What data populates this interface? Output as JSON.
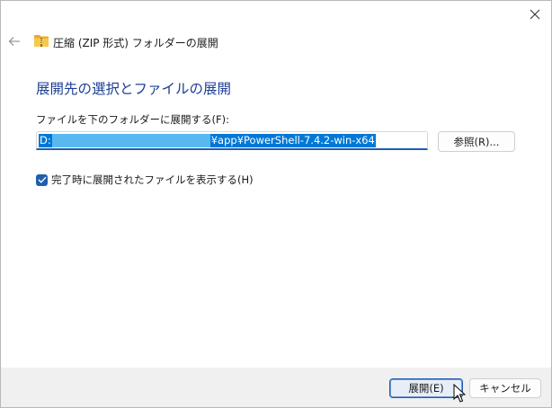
{
  "window": {
    "title": "圧縮 (ZIP 形式) フォルダーの展開"
  },
  "main": {
    "heading": "展開先の選択とファイルの展開",
    "field_label": "ファイルを下のフォルダーに展開する(F):",
    "path_value_start": "D:",
    "path_value_end": "¥app¥PowerShell-7.4.2-win-x64",
    "browse_label": "参照(R)...",
    "show_files_checkbox": {
      "label": "完了時に展開されたファイルを表示する(H)",
      "checked": true
    }
  },
  "footer": {
    "extract_label": "展開(E)",
    "cancel_label": "キャンセル"
  },
  "icons": {
    "close": "close-icon",
    "back": "back-arrow-icon",
    "folder": "zip-folder-icon",
    "check": "checkmark-icon",
    "cursor": "mouse-pointer-icon"
  },
  "colors": {
    "accent": "#1f5fae",
    "heading": "#1c3f94",
    "selection": "#0078d7",
    "footer_bg": "#f0f0f0"
  }
}
